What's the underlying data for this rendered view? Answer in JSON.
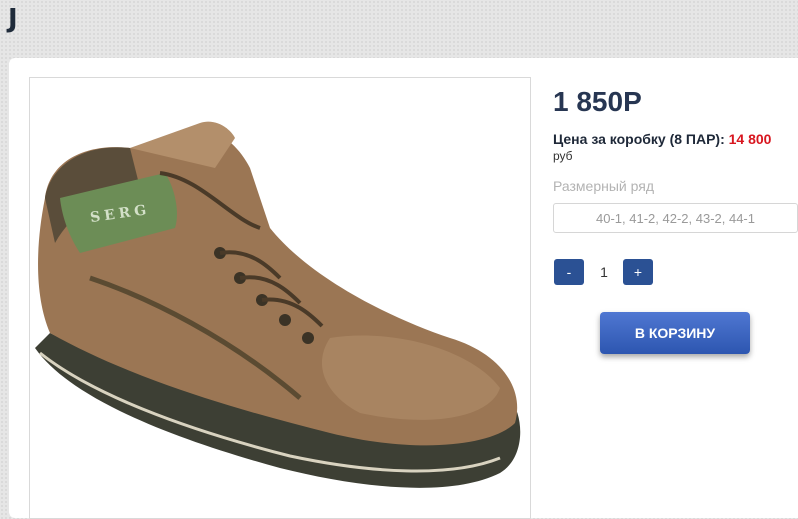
{
  "logo": {
    "letter": "J"
  },
  "product": {
    "image_name": "brown-leather-boot-image",
    "brand_text": "SERG",
    "price": "1 850Р",
    "box_price_label": "Цена за коробку (8 ПАР):",
    "box_price_value": "14 800",
    "box_price_currency": "руб",
    "size_range_label": "Размерный ряд",
    "size_range_value": "40-1, 41-2, 42-2, 43-2, 44-1",
    "quantity": "1",
    "minus_label": "-",
    "plus_label": "+",
    "cart_button_label": "В КОРЗИНУ"
  },
  "colors": {
    "price": "#273652",
    "box_price_amount": "#d8161f",
    "button_blue": "#2b5194"
  }
}
